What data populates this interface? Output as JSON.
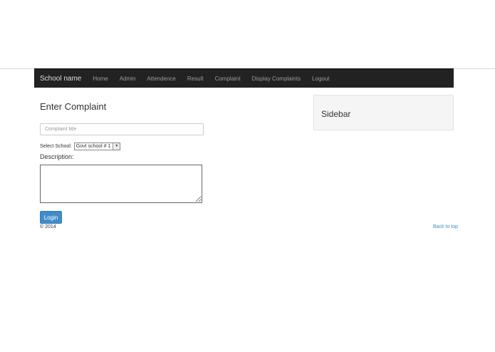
{
  "navbar": {
    "brand": "School name",
    "items": [
      {
        "label": "Home"
      },
      {
        "label": "Admin"
      },
      {
        "label": "Attendence"
      },
      {
        "label": "Result"
      },
      {
        "label": "Complaint"
      },
      {
        "label": "Display Complaints"
      },
      {
        "label": "Logout"
      }
    ]
  },
  "main": {
    "title": "Enter Complaint",
    "complaint_title": {
      "placeholder": "Complaint title",
      "value": ""
    },
    "school_select": {
      "label": "Select School:",
      "selected": "Govt school # 1"
    },
    "description": {
      "label": "Description:",
      "value": ""
    },
    "submit_label": "Login"
  },
  "sidebar": {
    "title": "Sidebar"
  },
  "footer": {
    "copyright": "© 2014",
    "back_to_top": "Back to top"
  },
  "colors": {
    "navbar_bg": "#222222",
    "primary": "#428bca",
    "sidebar_bg": "#f5f5f5"
  },
  "icons": {
    "select_arrow": "chevron-down-icon"
  }
}
